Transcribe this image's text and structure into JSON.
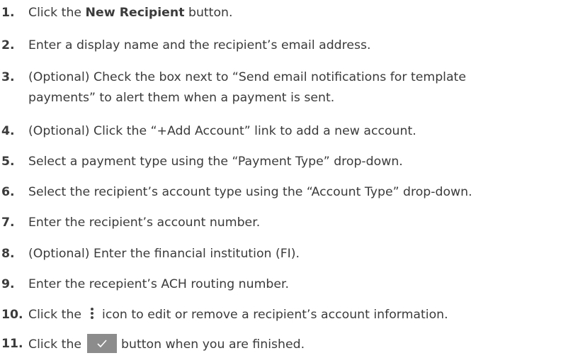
{
  "steps": [
    {
      "num": "1.",
      "pre": "Click the ",
      "bold": "New Recipient",
      "post": " button."
    },
    {
      "num": "2.",
      "text": "Enter a display name and the recipient’s email address."
    },
    {
      "num": "3.",
      "line1": "(Optional) Check the box next to “Send email notifications for template",
      "line2": "payments” to alert them when a payment is sent."
    },
    {
      "num": "4.",
      "text": "(Optional) Click the “+Add Account” link to add a new account."
    },
    {
      "num": "5.",
      "text": "Select a payment type using the “Payment Type” drop-down."
    },
    {
      "num": "6.",
      "text": "Select the recipient’s account type using the “Account Type” drop-down."
    },
    {
      "num": "7.",
      "text": "Enter the recipient’s account number."
    },
    {
      "num": "8.",
      "text": "(Optional) Enter the financial institution (FI)."
    },
    {
      "num": "9.",
      "text": "Enter the recepient’s ACH routing number."
    },
    {
      "num": "10.",
      "pre": "Click the",
      "post": "icon to edit or remove a recipient’s account information.",
      "icon": "kebab-menu-icon"
    },
    {
      "num": "11.",
      "pre": "Click the",
      "post": "button when you are finished.",
      "icon": "check-icon"
    }
  ]
}
